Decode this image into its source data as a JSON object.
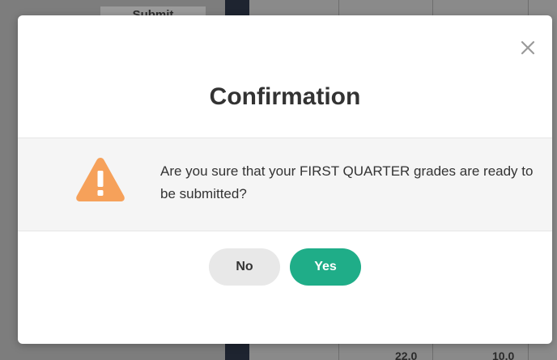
{
  "background": {
    "submit_label": "Submit",
    "bottom_values": [
      "",
      "22.0",
      "10.0"
    ]
  },
  "modal": {
    "close_icon": "close-icon",
    "title": "Confirmation",
    "warning_icon": "warning-triangle-icon",
    "message": "Are you sure that your FIRST QUARTER grades are ready to be submitted?",
    "buttons": {
      "no_label": "No",
      "yes_label": "Yes"
    },
    "colors": {
      "warning": "#f6a15a",
      "yes_button": "#1fad88",
      "no_button": "#e8e8e8",
      "overlay": "#7a7a7a"
    }
  }
}
